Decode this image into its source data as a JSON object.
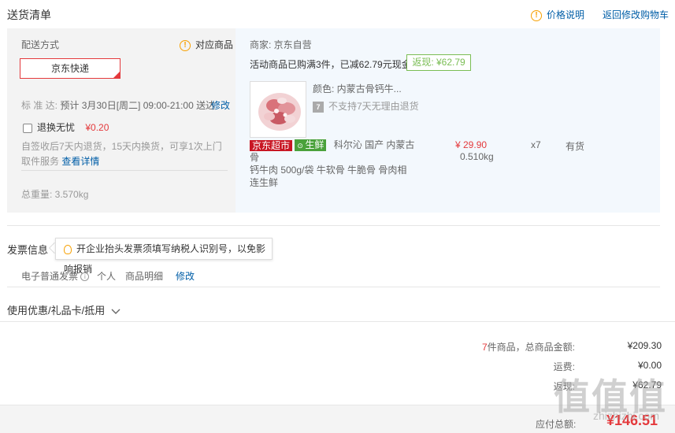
{
  "header": {
    "title": "送货清单",
    "price_info": "价格说明",
    "back_to_cart": "返回修改购物车"
  },
  "shipping": {
    "method_label": "配送方式",
    "match_items": "对应商品",
    "method": "京东快递",
    "schedule_label": "标 准 达:",
    "schedule": "预计 3月30日[周二] 09:00-21:00 送达",
    "modify": "修改",
    "worry_free_label": "退换无忧",
    "worry_free_price": "¥0.20",
    "worry_free_desc": "自签收后7天内退货，15天内换货，可享1次上门取件服务",
    "view_detail": "查看详情",
    "total_weight": "总重量: 3.570kg"
  },
  "order": {
    "merchant": "商家: 京东自营",
    "promo": "活动商品已购满3件，已减62.79元现金",
    "return_badge": "返现: ¥62.79",
    "product": {
      "color": "颜色: 内蒙古骨钙牛...",
      "no_return": "不支持7天无理由退货",
      "tag_supermarket": "京东超市",
      "tag_fresh": "生鲜",
      "name_line1": "科尔沁 国产 内蒙古骨",
      "name_line2": "钙牛肉 500g/袋 牛软骨 牛脆骨 骨肉相连生鲜",
      "price": "¥ 29.90",
      "weight": "0.510kg",
      "qty": "x7",
      "stock": "有货"
    }
  },
  "invoice": {
    "title": "发票信息",
    "tooltip": "开企业抬头发票须填写纳税人识别号，以免影响报销",
    "type": "电子普通发票",
    "personal": "个人",
    "detail": "商品明细",
    "modify": "修改"
  },
  "coupon": {
    "label": "使用优惠/礼品卡/抵用"
  },
  "summary": {
    "count": "7",
    "count_suffix": "件商品，总商品金额:",
    "total_amount": "¥209.30",
    "shipping_label": "运费:",
    "shipping_amount": "¥0.00",
    "cashback_label": "返现:",
    "cashback_amount": "¥62.79",
    "payable_label": "应付总额:",
    "payable_amount": "¥146.51"
  },
  "watermark": {
    "logo": "值值值",
    "site": "zhizhizhi.com"
  },
  "colors": {
    "accent_red": "#e4393c",
    "link_blue": "#005ea7",
    "cashback_green": "#7abd54",
    "warn_orange": "#f7a000"
  }
}
